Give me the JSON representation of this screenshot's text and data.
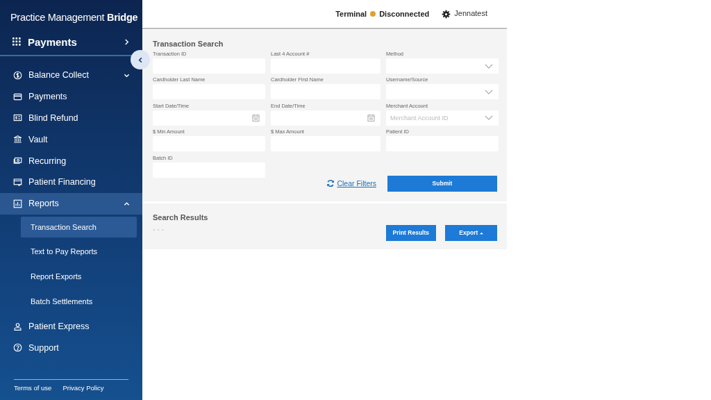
{
  "brand": {
    "light": "Practice Management ",
    "bold": "Bridge"
  },
  "module": {
    "label": "Payments"
  },
  "nav": [
    {
      "label": "Balance Collect",
      "expanded": false,
      "selected": false
    },
    {
      "label": "Payments",
      "selected": false
    },
    {
      "label": "Blind Refund",
      "selected": false
    },
    {
      "label": "Vault",
      "selected": false
    },
    {
      "label": "Recurring",
      "selected": false
    },
    {
      "label": "Patient Financing",
      "selected": false
    },
    {
      "label": "Reports",
      "expanded": true,
      "selected": true,
      "children": [
        {
          "label": "Transaction Search",
          "selected": true
        },
        {
          "label": "Text to Pay Reports",
          "selected": false
        },
        {
          "label": "Report Exports",
          "selected": false
        },
        {
          "label": "Batch Settlements",
          "selected": false
        }
      ]
    },
    {
      "label": "Patient Express",
      "selected": false
    },
    {
      "label": "Support",
      "selected": false
    }
  ],
  "footer_links": [
    "Terms of use",
    "Privacy Policy"
  ],
  "header": {
    "terminal_label": "Terminal",
    "terminal_status": "Disconnected",
    "user": "Jennatest"
  },
  "search": {
    "title": "Transaction Search",
    "columns": [
      [
        {
          "label": "Transaction ID",
          "kind": "text"
        },
        {
          "label": "Cardholder Last Name",
          "kind": "text"
        },
        {
          "label": "Start Date/Time",
          "kind": "date"
        },
        {
          "label": "$ Min Amount",
          "kind": "text"
        },
        {
          "label": "Batch ID",
          "kind": "text"
        }
      ],
      [
        {
          "label": "Last 4 Account #",
          "kind": "text"
        },
        {
          "label": "Cardholder First Name",
          "kind": "text"
        },
        {
          "label": "End Date/Time",
          "kind": "date"
        },
        {
          "label": "$ Max Amount",
          "kind": "text"
        }
      ],
      [
        {
          "label": "Method",
          "kind": "select"
        },
        {
          "label": "Username/Source",
          "kind": "select"
        },
        {
          "label": "Merchant Account",
          "kind": "select",
          "placeholder": "Merchant Account ID"
        },
        {
          "label": "Patient ID",
          "kind": "text"
        }
      ]
    ],
    "clear_label": "Clear Filters",
    "submit_label": "Submit"
  },
  "results": {
    "title": "Search Results",
    "print_label": "Print Results",
    "export_label": "Export"
  }
}
